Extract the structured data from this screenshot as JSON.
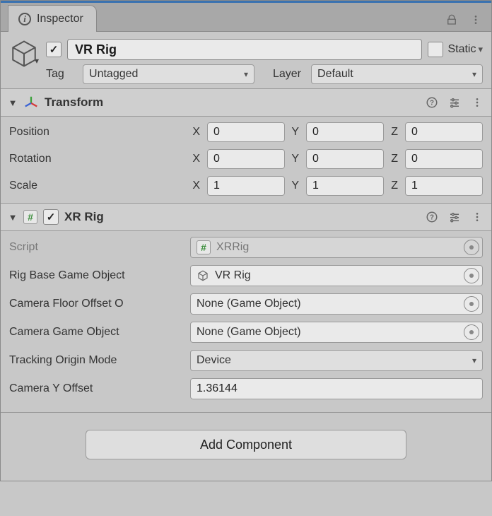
{
  "tab": {
    "title": "Inspector"
  },
  "gameObject": {
    "enabled": true,
    "name": "VR Rig",
    "static_label": "Static",
    "tag_label": "Tag",
    "tag_value": "Untagged",
    "layer_label": "Layer",
    "layer_value": "Default"
  },
  "transform": {
    "title": "Transform",
    "position_label": "Position",
    "rotation_label": "Rotation",
    "scale_label": "Scale",
    "axes": {
      "x": "X",
      "y": "Y",
      "z": "Z"
    },
    "position": {
      "x": "0",
      "y": "0",
      "z": "0"
    },
    "rotation": {
      "x": "0",
      "y": "0",
      "z": "0"
    },
    "scale": {
      "x": "1",
      "y": "1",
      "z": "1"
    }
  },
  "xrrig": {
    "title": "XR Rig",
    "enabled": true,
    "rows": {
      "script_label": "Script",
      "script_value": "XRRig",
      "rig_base_label": "Rig Base Game Object",
      "rig_base_value": "VR Rig",
      "floor_offset_label": "Camera Floor Offset O",
      "floor_offset_value": "None (Game Object)",
      "camera_obj_label": "Camera Game Object",
      "camera_obj_value": "None (Game Object)",
      "tracking_mode_label": "Tracking Origin Mode",
      "tracking_mode_value": "Device",
      "cam_y_offset_label": "Camera Y Offset",
      "cam_y_offset_value": "1.36144"
    }
  },
  "add_component_label": "Add Component"
}
